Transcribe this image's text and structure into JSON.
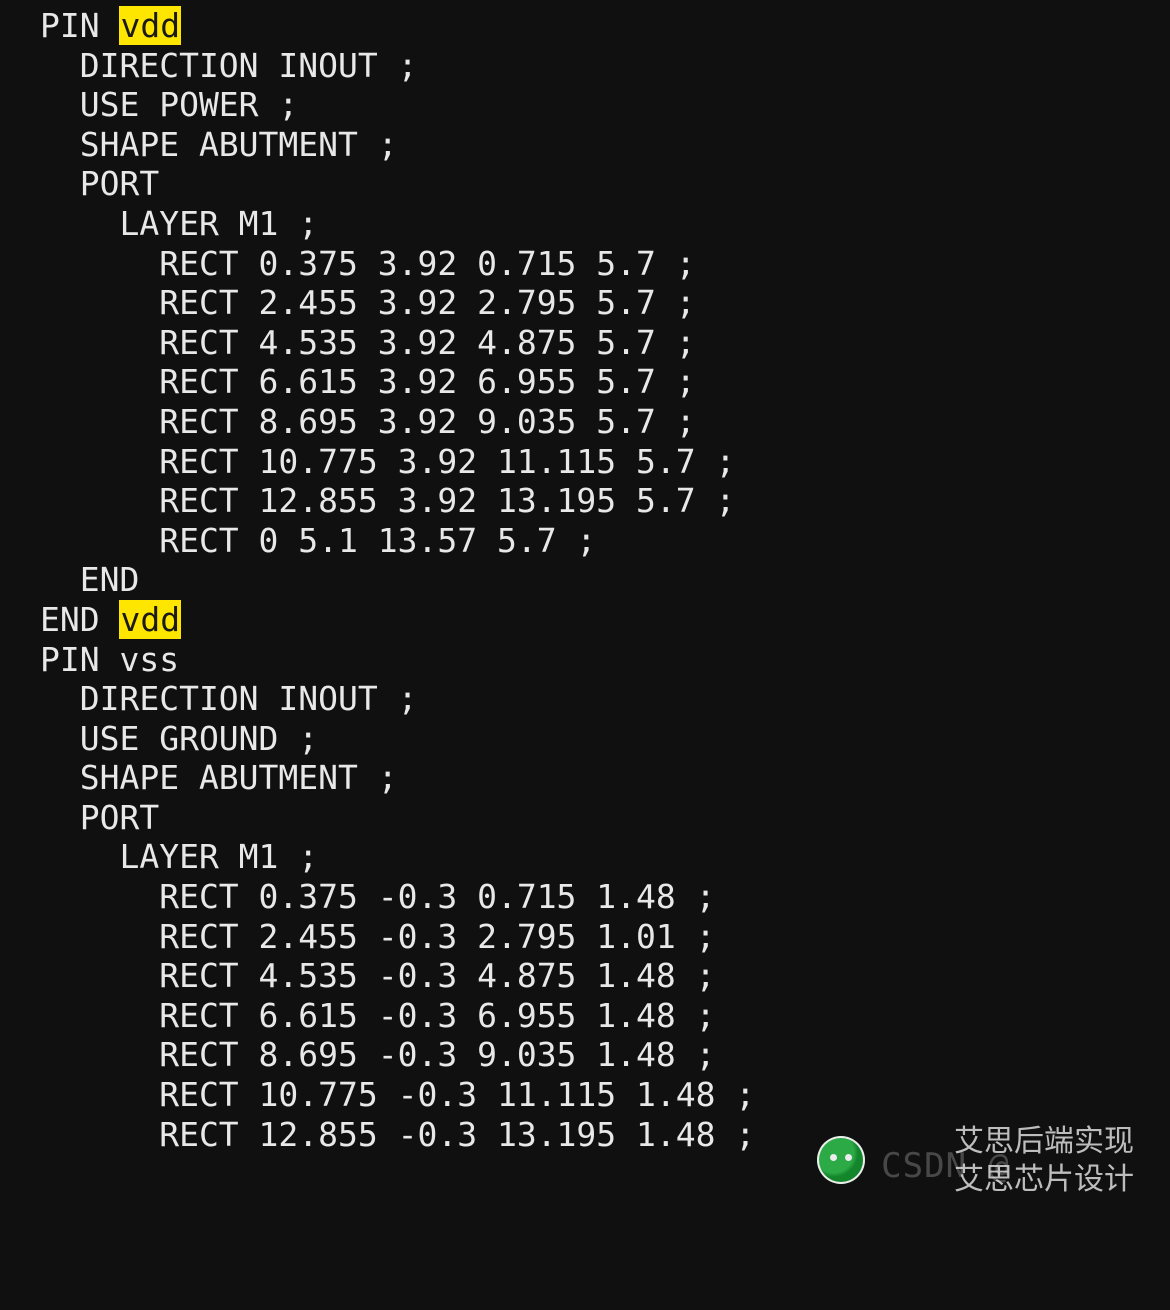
{
  "lef": {
    "pins": [
      {
        "name": "vdd",
        "highlight": true,
        "direction": "INOUT",
        "use": "POWER",
        "shape": "ABUTMENT",
        "port": {
          "layer": "M1",
          "rects": [
            [
              0.375,
              3.92,
              0.715,
              5.7
            ],
            [
              2.455,
              3.92,
              2.795,
              5.7
            ],
            [
              4.535,
              3.92,
              4.875,
              5.7
            ],
            [
              6.615,
              3.92,
              6.955,
              5.7
            ],
            [
              8.695,
              3.92,
              9.035,
              5.7
            ],
            [
              10.775,
              3.92,
              11.115,
              5.7
            ],
            [
              12.855,
              3.92,
              13.195,
              5.7
            ],
            [
              0,
              5.1,
              13.57,
              5.7
            ]
          ]
        },
        "show_end": true
      },
      {
        "name": "vss",
        "highlight": false,
        "direction": "INOUT",
        "use": "GROUND",
        "shape": "ABUTMENT",
        "port": {
          "layer": "M1",
          "rects": [
            [
              0.375,
              -0.3,
              0.715,
              1.48
            ],
            [
              2.455,
              -0.3,
              2.795,
              1.01
            ],
            [
              4.535,
              -0.3,
              4.875,
              1.48
            ],
            [
              6.615,
              -0.3,
              6.955,
              1.48
            ],
            [
              8.695,
              -0.3,
              9.035,
              1.48
            ],
            [
              10.775,
              -0.3,
              11.115,
              1.48
            ],
            [
              12.855,
              -0.3,
              13.195,
              1.48
            ]
          ]
        },
        "show_end": false
      }
    ]
  },
  "watermark": {
    "csdn": "CSDN @",
    "line1": "艾思后端实现",
    "line2": "艾思芯片设计"
  }
}
